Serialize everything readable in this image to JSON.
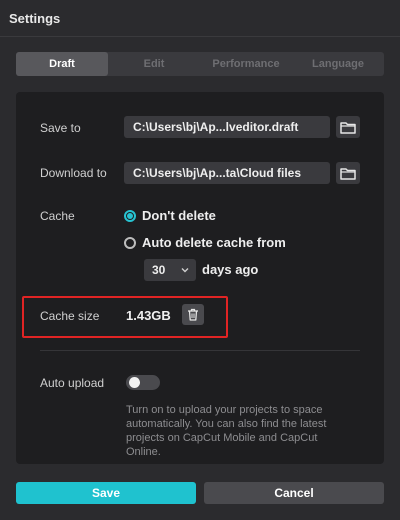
{
  "window": {
    "title": "Settings"
  },
  "tabs": [
    {
      "label": "Draft",
      "active": true
    },
    {
      "label": "Edit",
      "active": false
    },
    {
      "label": "Performance",
      "active": false
    },
    {
      "label": "Language",
      "active": false
    }
  ],
  "draft": {
    "save_to": {
      "label": "Save to",
      "value": "C:\\Users\\bj\\Ap...lveditor.draft"
    },
    "download_to": {
      "label": "Download to",
      "value": "C:\\Users\\bj\\Ap...ta\\Cloud files"
    },
    "cache": {
      "label": "Cache",
      "options": [
        {
          "label": "Don't delete",
          "checked": true
        },
        {
          "label": "Auto delete cache from",
          "checked": false
        }
      ],
      "days_value": "30",
      "days_suffix": "days ago"
    },
    "cache_size": {
      "label": "Cache size",
      "value": "1.43GB"
    },
    "auto_upload": {
      "label": "Auto upload",
      "enabled": false,
      "description": "Turn on to upload your projects to space automatically. You can also find the latest projects on CapCut Mobile and CapCut Online."
    }
  },
  "footer": {
    "save_label": "Save",
    "cancel_label": "Cancel"
  },
  "colors": {
    "accent": "#1fc2cf",
    "highlight": "#e02424",
    "background": "#2b2b2e",
    "panel": "#1e1e20"
  },
  "icons": {
    "folder": "folder-icon",
    "trash": "trash-icon",
    "chevron": "chevron-down-icon"
  }
}
